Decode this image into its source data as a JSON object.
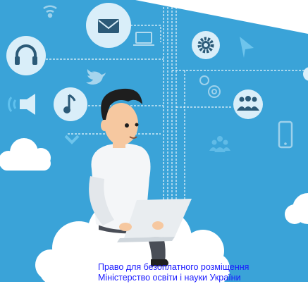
{
  "caption": {
    "line1": "Право для безоплатного розміщення",
    "line2": "Міністерство освіти і науки України",
    "color": "#1a1aff"
  },
  "colors": {
    "panel": "#3aa3d8",
    "cloud": "#ffffff",
    "icon_dark": "#2b5a78",
    "icon_white": "#ffffff",
    "shirt": "#f4f6f8",
    "hair": "#1e1e1e",
    "skin": "#f6c8a0",
    "trousers": "#4a4e57",
    "laptop": "#e9edf0"
  },
  "icons": [
    "wifi-icon",
    "mail-icon",
    "laptop-icon",
    "headphones-icon",
    "bird-icon",
    "music-note-icon",
    "speaker-icon",
    "chevron-icon",
    "gear-icon",
    "send-icon",
    "gears-icon",
    "users-icon",
    "group-icon",
    "smartphone-icon"
  ]
}
